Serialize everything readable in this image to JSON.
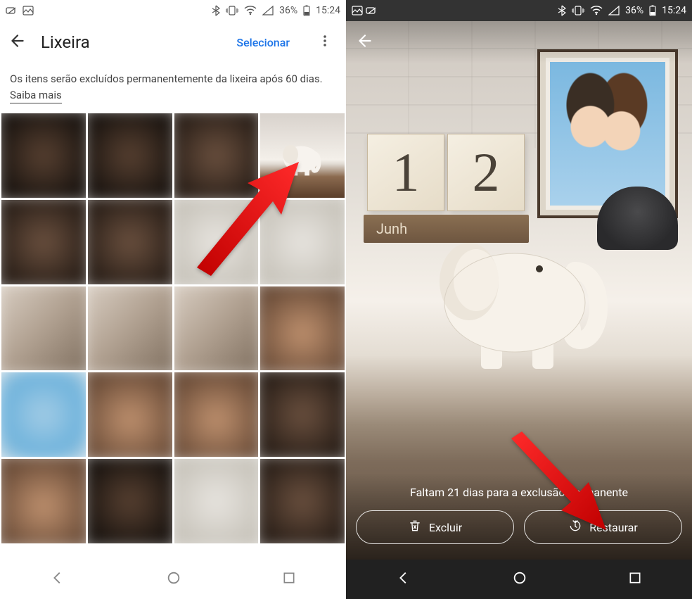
{
  "status": {
    "battery_pct": "36%",
    "time": "15:24"
  },
  "left": {
    "title": "Lixeira",
    "select": "Selecionar",
    "info_line": "Os itens serão excluídos permanentemente da lixeira após 60 dias.",
    "learn_more": "Saiba mais"
  },
  "right": {
    "calendar_digit1": "1",
    "calendar_digit2": "2",
    "calendar_month": "Junh",
    "status_msg": "Faltam 21 dias para a exclusão permanente",
    "delete_label": "Excluir",
    "restore_label": "Restaurar"
  }
}
